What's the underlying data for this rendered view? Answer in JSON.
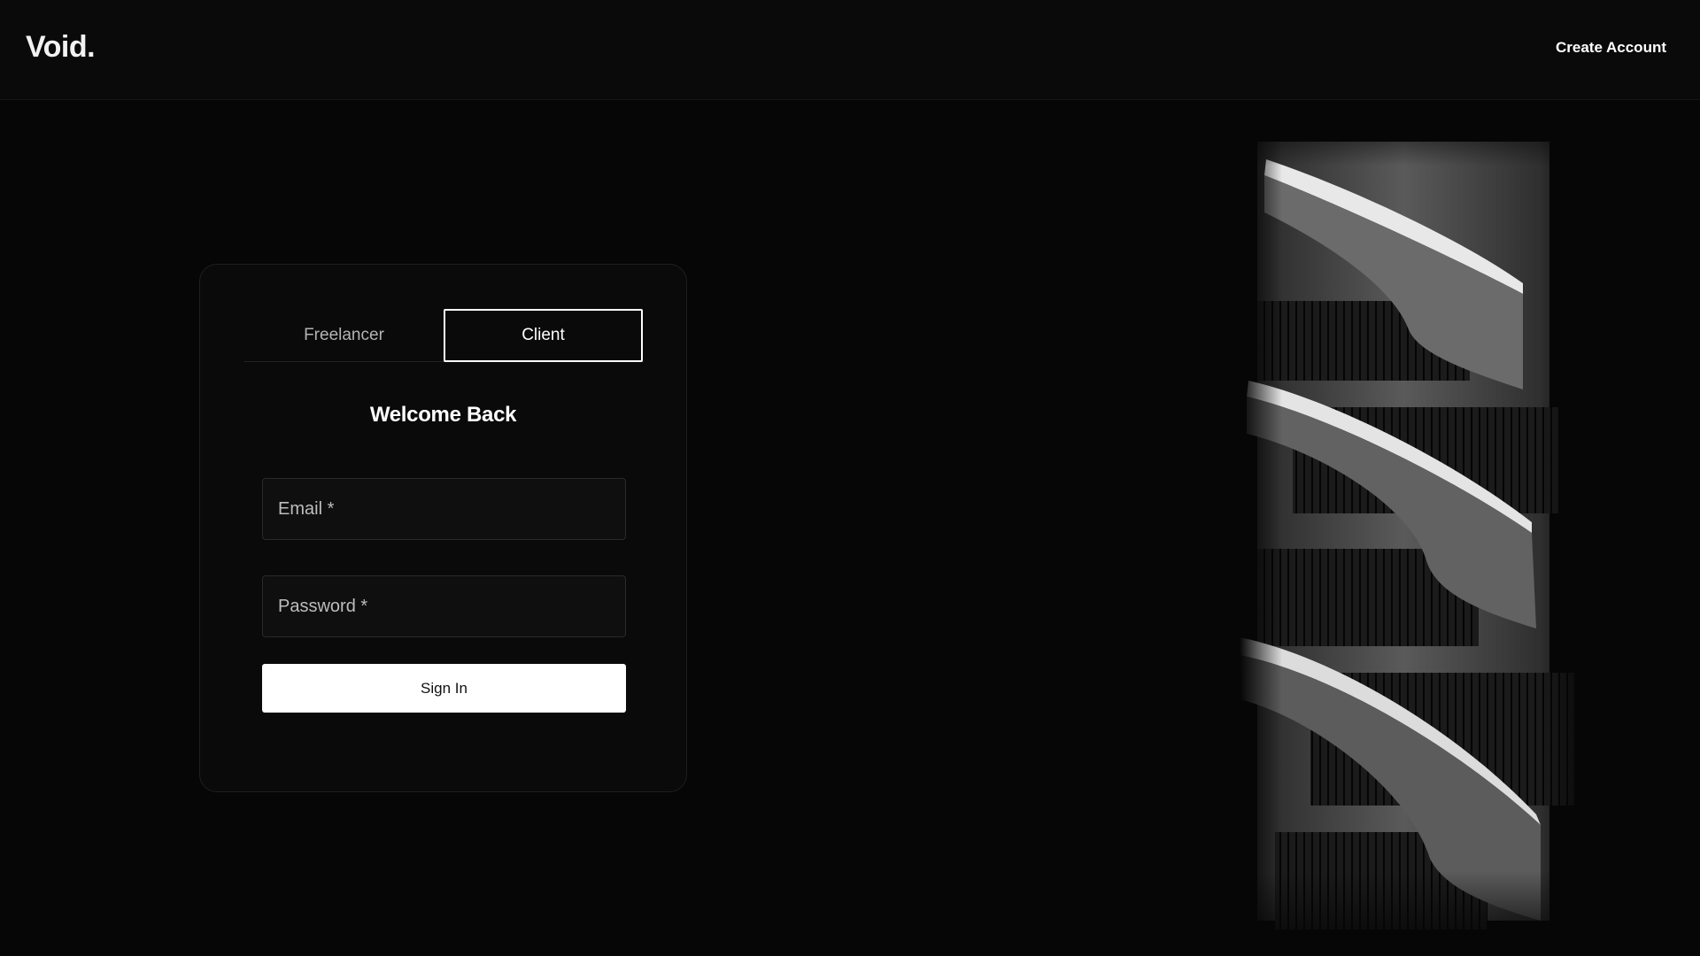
{
  "header": {
    "logo": "Void.",
    "create_account_label": "Create Account"
  },
  "login": {
    "tabs": [
      {
        "label": "Freelancer",
        "active": false
      },
      {
        "label": "Client",
        "active": true
      }
    ],
    "title": "Welcome Back",
    "email_placeholder": "Email *",
    "password_placeholder": "Password *",
    "signin_label": "Sign In"
  },
  "hero_image": {
    "subject": "black-and-white spiral staircases"
  },
  "colors": {
    "background": "#060606",
    "header": "#0a0a0a",
    "card": "#0a0a0a",
    "accent": "#ffffff"
  }
}
